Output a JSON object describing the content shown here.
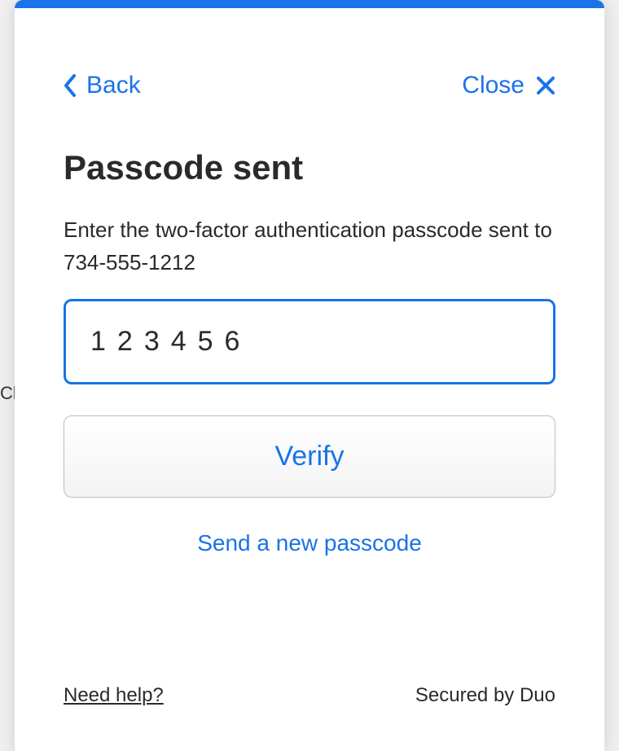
{
  "background": {
    "partial_text": "Ch"
  },
  "header": {
    "back_label": "Back",
    "close_label": "Close"
  },
  "main": {
    "title": "Passcode sent",
    "subtitle": "Enter the two-factor authentication passcode sent to 734-555-1212",
    "passcode_value": "123456",
    "verify_label": "Verify",
    "resend_label": "Send a new passcode"
  },
  "footer": {
    "help_label": "Need help?",
    "secured_label": "Secured by Duo"
  }
}
